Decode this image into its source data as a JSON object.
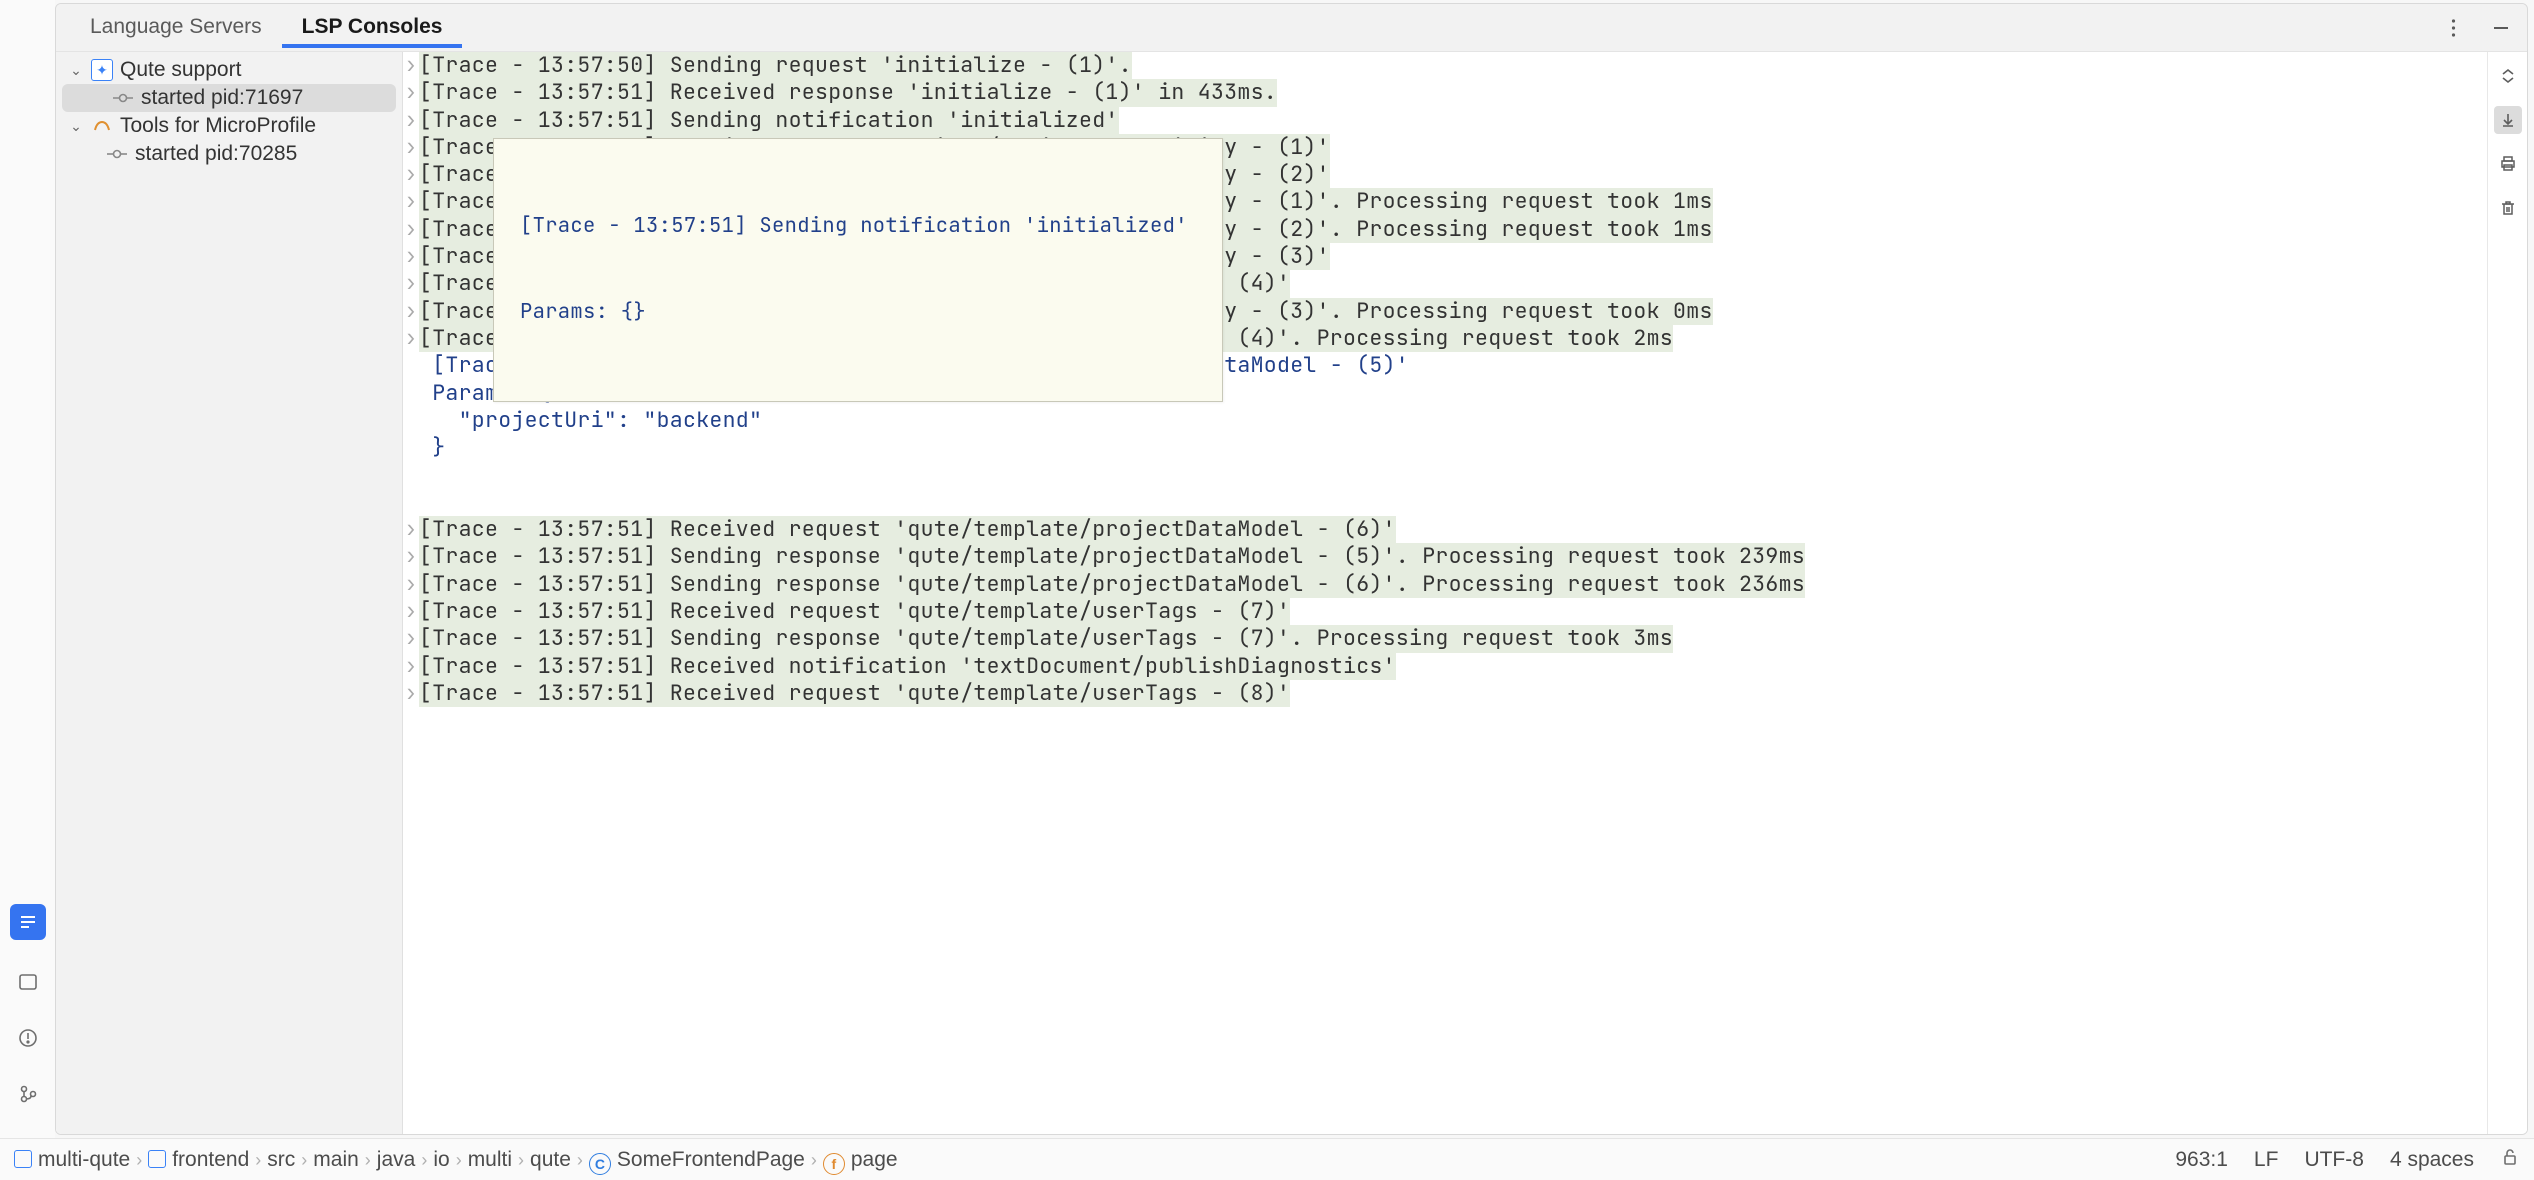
{
  "tabs": {
    "items": [
      {
        "label": "Language Servers",
        "active": false
      },
      {
        "label": "LSP Consoles",
        "active": true
      }
    ]
  },
  "tree": {
    "nodes": [
      {
        "label": "Qute support",
        "level": 1,
        "expanded": true,
        "iconType": "puzzle"
      },
      {
        "label": "started pid:71697",
        "level": 2,
        "selected": true,
        "iconType": "commit"
      },
      {
        "label": "Tools for MicroProfile",
        "level": 1,
        "expanded": true,
        "iconType": "mp"
      },
      {
        "label": "started pid:70285",
        "level": 2,
        "iconType": "commit"
      }
    ]
  },
  "console": {
    "lines": [
      {
        "fold": true,
        "hl": true,
        "text": "[Trace - 13:57:50] Sending request 'initialize - (1)'."
      },
      {
        "fold": true,
        "hl": true,
        "text": "[Trace - 13:57:51] Received response 'initialize - (1)' in 433ms."
      },
      {
        "fold": true,
        "hl": true,
        "text": "[Trace - 13:57:51] Sending notification 'initialized'"
      },
      {
        "fold": true,
        "hl": true,
        "text": "[Trace - 13:57:51] Received request 'client/registerCapability - (1)'"
      },
      {
        "fold": true,
        "hl": true,
        "text": "[Trace - 13:57:51] Received request 'client/registerCapability - (2)'"
      },
      {
        "fold": true,
        "hl": true,
        "text": "[Trace - 13:57:51] Sending response 'client/registerCapability - (1)'. Processing request took 1ms"
      },
      {
        "fold": true,
        "hl": true,
        "text": "[Trace - 13:57:51] Sending response 'client/registerCapability - (2)'. Processing request took 1ms"
      },
      {
        "fold": true,
        "hl": true,
        "text": "[Trace - 13:57:51] Received request 'client/registerCapability - (3)'"
      },
      {
        "fold": true,
        "hl": true,
        "text": "[Trace - 13:57:51] Received request 'qute/template/projects - (4)'"
      },
      {
        "fold": true,
        "hl": true,
        "text": "[Trace - 13:57:51] Sending response 'client/registerCapability - (3)'. Processing request took 0ms"
      },
      {
        "fold": true,
        "hl": true,
        "text": "[Trace - 13:57:51] Sending response 'qute/template/projects - (4)'. Processing request took 2ms"
      },
      {
        "fold": false,
        "blue": true,
        "text": " [Trace - 13:57:51] Received request 'qute/template/projectDataModel - (5)'"
      },
      {
        "fold": false,
        "blue": true,
        "text": " Params: {"
      },
      {
        "fold": false,
        "blue": true,
        "text": "   \"projectUri\": \"backend\""
      },
      {
        "fold": false,
        "blue": true,
        "text": " }"
      },
      {
        "fold": false,
        "text": ""
      },
      {
        "fold": false,
        "text": ""
      },
      {
        "fold": true,
        "hl": true,
        "text": "[Trace - 13:57:51] Received request 'qute/template/projectDataModel - (6)'"
      },
      {
        "fold": true,
        "hl": true,
        "text": "[Trace - 13:57:51] Sending response 'qute/template/projectDataModel - (5)'. Processing request took 239ms"
      },
      {
        "fold": true,
        "hl": true,
        "text": "[Trace - 13:57:51] Sending response 'qute/template/projectDataModel - (6)'. Processing request took 236ms"
      },
      {
        "fold": true,
        "hl": true,
        "text": "[Trace - 13:57:51] Received request 'qute/template/userTags - (7)'"
      },
      {
        "fold": true,
        "hl": true,
        "text": "[Trace - 13:57:51] Sending response 'qute/template/userTags - (7)'. Processing request took 3ms"
      },
      {
        "fold": true,
        "hl": true,
        "text": "[Trace - 13:57:51] Received notification 'textDocument/publishDiagnostics'"
      },
      {
        "fold": true,
        "hl": true,
        "text": "[Trace - 13:57:51] Received request 'qute/template/userTags - (8)'"
      }
    ]
  },
  "tooltip": {
    "line1": "[Trace - 13:57:51] Sending notification 'initialized'",
    "line2": "Params: {}"
  },
  "breadcrumbs": {
    "items": [
      {
        "label": "multi-qute",
        "icon": "pkg"
      },
      {
        "label": "frontend",
        "icon": "pkg"
      },
      {
        "label": "src"
      },
      {
        "label": "main"
      },
      {
        "label": "java"
      },
      {
        "label": "io"
      },
      {
        "label": "multi"
      },
      {
        "label": "qute"
      },
      {
        "label": "SomeFrontendPage",
        "icon": "class"
      },
      {
        "label": "page",
        "icon": "field"
      }
    ]
  },
  "status": {
    "position": "963:1",
    "lineSep": "LF",
    "encoding": "UTF-8",
    "indent": "4 spaces"
  }
}
